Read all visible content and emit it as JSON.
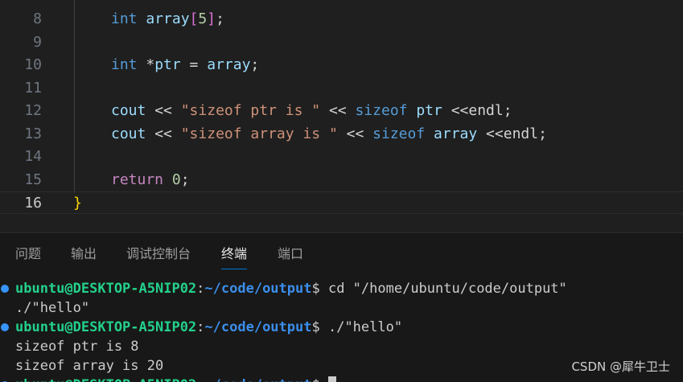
{
  "editor": {
    "lines": [
      {
        "number": "8",
        "tokens": [
          [
            "kw-type",
            "int"
          ],
          [
            "plain",
            " "
          ],
          [
            "var",
            "array"
          ],
          [
            "brk",
            "["
          ],
          [
            "num",
            "5"
          ],
          [
            "brk",
            "]"
          ],
          [
            "plain",
            ";"
          ]
        ]
      },
      {
        "number": "9",
        "tokens": []
      },
      {
        "number": "10",
        "tokens": [
          [
            "kw-type",
            "int"
          ],
          [
            "plain",
            " *"
          ],
          [
            "var",
            "ptr"
          ],
          [
            "plain",
            " = "
          ],
          [
            "var",
            "array"
          ],
          [
            "plain",
            ";"
          ]
        ]
      },
      {
        "number": "11",
        "tokens": []
      },
      {
        "number": "12",
        "tokens": [
          [
            "var",
            "cout"
          ],
          [
            "plain",
            " << "
          ],
          [
            "str",
            "\"sizeof ptr is \""
          ],
          [
            "plain",
            " << "
          ],
          [
            "kw-type",
            "sizeof"
          ],
          [
            "plain",
            " "
          ],
          [
            "var",
            "ptr"
          ],
          [
            "plain",
            " <<endl;"
          ]
        ]
      },
      {
        "number": "13",
        "tokens": [
          [
            "var",
            "cout"
          ],
          [
            "plain",
            " << "
          ],
          [
            "str",
            "\"sizeof array is \""
          ],
          [
            "plain",
            " << "
          ],
          [
            "kw-type",
            "sizeof"
          ],
          [
            "plain",
            " "
          ],
          [
            "var",
            "array"
          ],
          [
            "plain",
            " <<endl;"
          ]
        ]
      },
      {
        "number": "14",
        "tokens": []
      },
      {
        "number": "15",
        "tokens": [
          [
            "kw-ctrl",
            "return"
          ],
          [
            "plain",
            " "
          ],
          [
            "num",
            "0"
          ],
          [
            "plain",
            ";"
          ]
        ]
      },
      {
        "number": "16",
        "tokens": [
          [
            "brace",
            "}"
          ]
        ],
        "current": true,
        "outdent": true
      }
    ]
  },
  "panel": {
    "tabs": [
      "问题",
      "输出",
      "调试控制台",
      "终端",
      "端口"
    ],
    "active_tab": "终端"
  },
  "terminal": {
    "prompt_user": "ubuntu@DESKTOP-A5NIP02",
    "prompt_sep": ":",
    "prompt_path": "~/code/output",
    "prompt_dollar": "$",
    "lines": [
      {
        "type": "prompt",
        "command": " cd \"/home/ubuntu/code/output\""
      },
      {
        "type": "output",
        "text": "./\"hello\""
      },
      {
        "type": "prompt",
        "command": " ./\"hello\""
      },
      {
        "type": "output",
        "text": "sizeof ptr is 8"
      },
      {
        "type": "output",
        "text": "sizeof array is 20"
      },
      {
        "type": "prompt",
        "command": " ",
        "cursor": true
      }
    ]
  },
  "watermark": "CSDN @犀牛卫士",
  "colors": {
    "accent_blue": "#0078d4",
    "prompt_green": "#23d18b",
    "prompt_blue": "#3b8eea",
    "status_dot": "#3794ff"
  }
}
